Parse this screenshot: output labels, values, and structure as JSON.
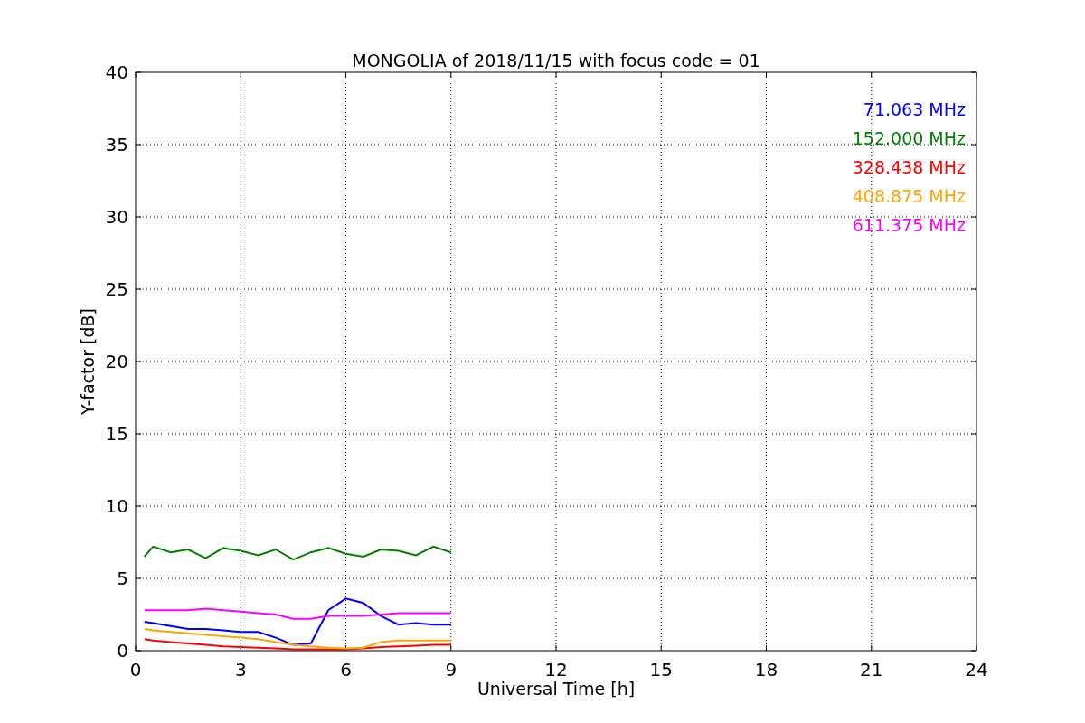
{
  "chart_data": {
    "type": "line",
    "title": "MONGOLIA of 2018/11/15 with focus code = 01",
    "xlabel": "Universal Time [h]",
    "ylabel": "Y-factor [dB]",
    "x": [
      0.25,
      0.5,
      1,
      1.5,
      2,
      2.5,
      3,
      3.5,
      4,
      4.5,
      5,
      5.5,
      6,
      6.5,
      7,
      7.5,
      8,
      8.5,
      9
    ],
    "series": [
      {
        "name": "71.063 MHz",
        "color": "#0000ff",
        "values": [
          2.0,
          1.9,
          1.7,
          1.5,
          1.5,
          1.4,
          1.3,
          1.3,
          0.9,
          0.4,
          0.5,
          2.8,
          3.6,
          3.3,
          2.4,
          1.8,
          1.9,
          1.8,
          1.8
        ]
      },
      {
        "name": "152.000 MHz",
        "color": "#008000",
        "values": [
          6.5,
          7.2,
          6.8,
          7.0,
          6.4,
          7.1,
          6.9,
          6.6,
          7.0,
          6.3,
          6.8,
          7.1,
          6.7,
          6.5,
          7.0,
          6.9,
          6.6,
          7.2,
          6.8
        ]
      },
      {
        "name": "328.438 MHz",
        "color": "#ff0000",
        "values": [
          0.8,
          0.7,
          0.6,
          0.5,
          0.4,
          0.3,
          0.25,
          0.2,
          0.15,
          0.1,
          0.1,
          0.1,
          0.1,
          0.15,
          0.25,
          0.3,
          0.35,
          0.4,
          0.4
        ]
      },
      {
        "name": "408.875 MHz",
        "color": "#ffa500",
        "values": [
          1.5,
          1.4,
          1.3,
          1.2,
          1.1,
          1.0,
          0.9,
          0.8,
          0.6,
          0.4,
          0.3,
          0.2,
          0.15,
          0.2,
          0.6,
          0.7,
          0.7,
          0.7,
          0.7
        ]
      },
      {
        "name": "611.375 MHz",
        "color": "#ff00ff",
        "values": [
          2.8,
          2.8,
          2.8,
          2.8,
          2.9,
          2.8,
          2.7,
          2.6,
          2.5,
          2.2,
          2.2,
          2.4,
          2.4,
          2.4,
          2.5,
          2.6,
          2.6,
          2.6,
          2.6
        ]
      }
    ],
    "xlim": [
      0,
      24
    ],
    "ylim": [
      0,
      40
    ],
    "xticks": [
      0,
      3,
      6,
      9,
      12,
      15,
      18,
      21,
      24
    ],
    "yticks": [
      0,
      5,
      10,
      15,
      20,
      25,
      30,
      35,
      40
    ],
    "grid": true
  }
}
